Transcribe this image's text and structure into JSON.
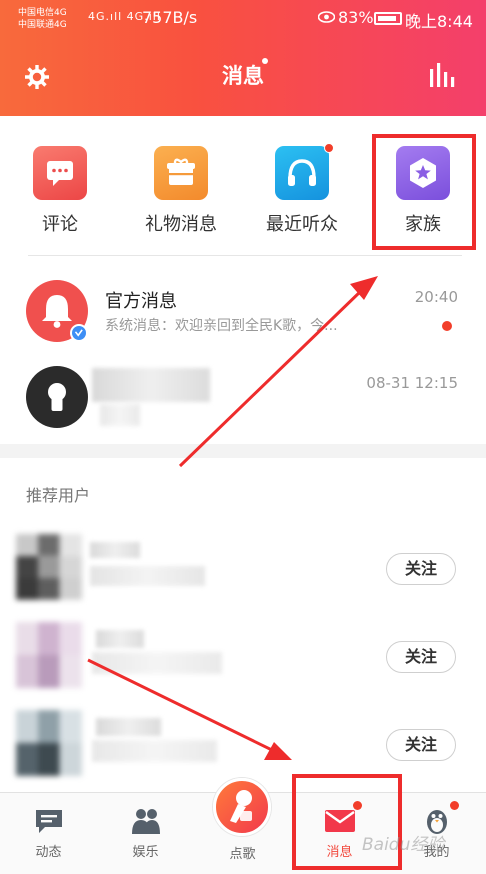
{
  "status_bar": {
    "carrier_1": "中国电信4G",
    "carrier_2": "中国联通4G",
    "signal": "4G.ıll 4G.ıll",
    "net_speed": "757B/s",
    "battery": "83%",
    "time": "晚上8:44"
  },
  "header": {
    "title": "消息",
    "settings_icon": "gear-icon",
    "stats_icon": "bar-chart-icon"
  },
  "quick_entries": [
    {
      "label": "评论",
      "icon": "comment-icon",
      "color": "#f15a5a",
      "badge": false
    },
    {
      "label": "礼物消息",
      "icon": "gift-icon",
      "color": "#f79a35",
      "badge": false
    },
    {
      "label": "最近听众",
      "icon": "headphones-icon",
      "color": "#1aa3e8",
      "badge": true
    },
    {
      "label": "家族",
      "icon": "family-shield-icon",
      "color": "#8e63e6",
      "badge": false
    }
  ],
  "messages": [
    {
      "title": "官方消息",
      "subtitle": "系统消息：欢迎亲回到全民K歌，今...",
      "time": "20:40",
      "unread": true
    },
    {
      "title": "",
      "subtitle": "",
      "time": "08-31 12:15",
      "unread": false
    }
  ],
  "recommend": {
    "title": "推荐用户",
    "follow_label": "关注",
    "users": [
      {
        "name": "",
        "follow": "关注"
      },
      {
        "name": "",
        "follow": "关注"
      },
      {
        "name": "",
        "follow": "关注"
      }
    ]
  },
  "nav": {
    "items": [
      {
        "label": "动态",
        "icon": "feed-icon",
        "active": false,
        "badge": false
      },
      {
        "label": "娱乐",
        "icon": "people-icon",
        "active": false,
        "badge": false
      },
      {
        "label": "点歌",
        "icon": "microphone-icon",
        "active": false,
        "badge": false
      },
      {
        "label": "消息",
        "icon": "envelope-icon",
        "active": true,
        "badge": true
      },
      {
        "label": "我的",
        "icon": "penguin-icon",
        "active": false,
        "badge": true
      }
    ]
  },
  "watermark": "Baidu经验",
  "colors": {
    "brand": "#f9513f",
    "highlight": "#ee2c2c",
    "badge": "#f23e2a"
  }
}
